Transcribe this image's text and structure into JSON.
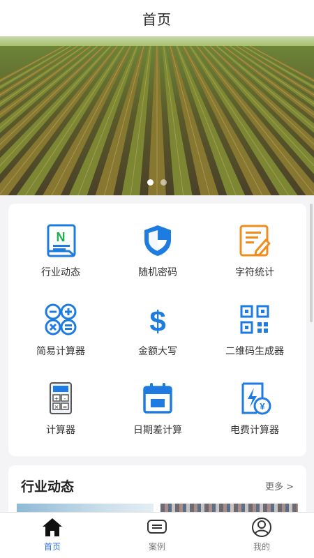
{
  "header": {
    "title": "首页"
  },
  "banner": {
    "image": "farm-field-rows",
    "slide_count": 2,
    "active_slide": 1
  },
  "tools": [
    {
      "label": "行业动态",
      "icon": "news-icon",
      "color": "#1e7be0"
    },
    {
      "label": "随机密码",
      "icon": "shield-icon",
      "color": "#1e7be0"
    },
    {
      "label": "字符统计",
      "icon": "edit-document-icon",
      "color": "#f08c1e"
    },
    {
      "label": "简易计算器",
      "icon": "calculator-ops-icon",
      "color": "#1e7be0"
    },
    {
      "label": "金额大写",
      "icon": "dollar-icon",
      "color": "#1e7be0"
    },
    {
      "label": "二维码生成器",
      "icon": "qrcode-icon",
      "color": "#1e7be0"
    },
    {
      "label": "计算器",
      "icon": "calculator-icon",
      "color": "#1e7be0"
    },
    {
      "label": "日期差计算",
      "icon": "calendar-icon",
      "color": "#1e7be0"
    },
    {
      "label": "电费计算器",
      "icon": "electricity-bill-icon",
      "color": "#1e7be0"
    }
  ],
  "news": {
    "title": "行业动态",
    "more": "更多 >"
  },
  "tabbar": {
    "items": [
      {
        "label": "首页",
        "icon": "home-icon",
        "active": true
      },
      {
        "label": "案例",
        "icon": "message-icon",
        "active": false
      },
      {
        "label": "我的",
        "icon": "user-icon",
        "active": false
      }
    ],
    "active_color": "#2f6fe0",
    "inactive_color": "#777777"
  }
}
